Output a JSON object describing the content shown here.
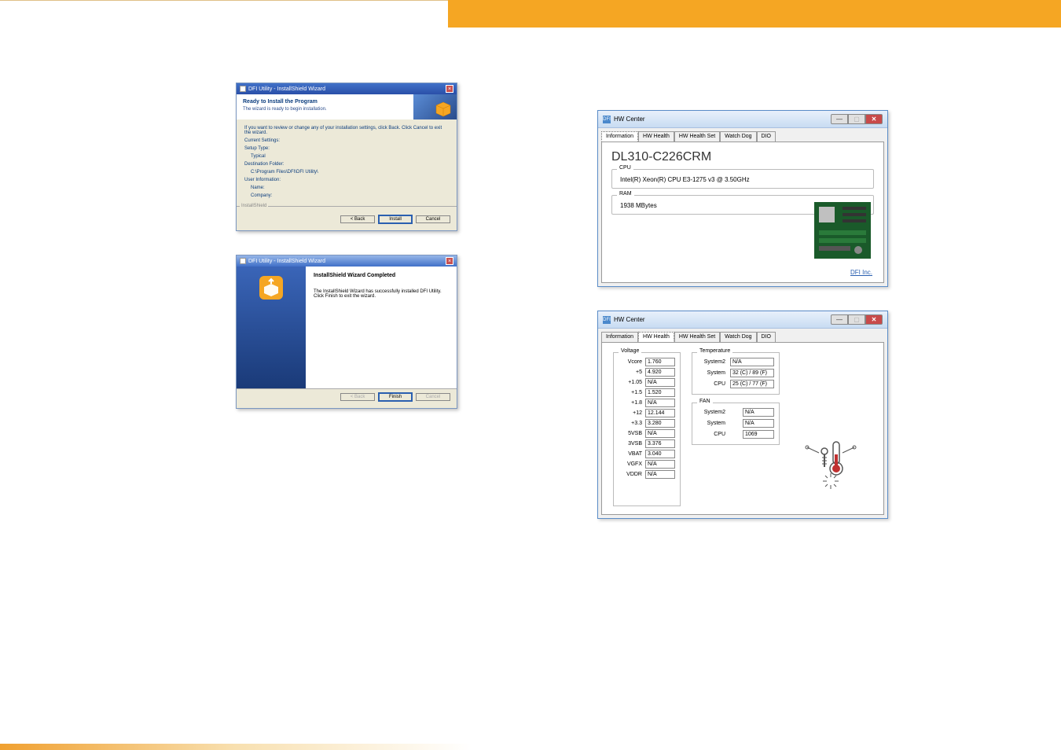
{
  "dialog1": {
    "title": "DFI Utility - InstallShield Wizard",
    "heading": "Ready to Install the Program",
    "subheading": "The wizard is ready to begin installation.",
    "instruction": "If you want to review or change any of your installation settings, click Back. Click Cancel to exit the wizard.",
    "current_settings_label": "Current Settings:",
    "setup_type_label": "Setup Type:",
    "setup_type_value": "Typical",
    "dest_folder_label": "Destination Folder:",
    "dest_folder_value": "C:\\Program Files\\DFI\\DFI Utility\\",
    "user_info_label": "User Information:",
    "name_label": "Name:",
    "company_label": "Company:",
    "sep_label": "InstallShield",
    "back_btn": "< Back",
    "install_btn": "Install",
    "cancel_btn": "Cancel"
  },
  "dialog2": {
    "title": "DFI Utility - InstallShield Wizard",
    "heading": "InstallShield Wizard Completed",
    "body1": "The InstallShield Wizard has successfully installed DFI Utility. Click Finish to exit the wizard.",
    "back_btn": "< Back",
    "finish_btn": "Finish",
    "cancel_btn": "Cancel"
  },
  "hw1": {
    "icon_text": "DFI",
    "title": "HW Center",
    "tabs": {
      "info": "Information",
      "hw_health": "HW Health",
      "hw_health_set": "HW Health Set",
      "watch_dog": "Watch Dog",
      "dio": "DIO"
    },
    "product": "DL310-C226CRM",
    "cpu_label": "CPU",
    "cpu_value": "Intel(R) Xeon(R) CPU E3-1275 v3 @ 3.50GHz",
    "ram_label": "RAM",
    "ram_value": "1938 MBytes",
    "link": "DFI Inc."
  },
  "hw2": {
    "title": "HW Center",
    "tabs": {
      "info": "Information",
      "hw_health": "HW Health",
      "hw_health_set": "HW Health Set",
      "watch_dog": "Watch Dog",
      "dio": "DIO"
    },
    "voltage_label": "Voltage",
    "voltages": [
      {
        "lbl": "Vcore",
        "val": "1.760"
      },
      {
        "lbl": "+5",
        "val": "4.920"
      },
      {
        "lbl": "+1.05",
        "val": "N/A"
      },
      {
        "lbl": "+1.5",
        "val": "1.520"
      },
      {
        "lbl": "+1.8",
        "val": "N/A"
      },
      {
        "lbl": "+12",
        "val": "12.144"
      },
      {
        "lbl": "+3.3",
        "val": "3.280"
      },
      {
        "lbl": "5VSB",
        "val": "N/A"
      },
      {
        "lbl": "3VSB",
        "val": "3.376"
      },
      {
        "lbl": "VBAT",
        "val": "3.040"
      },
      {
        "lbl": "VGFX",
        "val": "N/A"
      },
      {
        "lbl": "VDDR",
        "val": "N/A"
      }
    ],
    "temp_label": "Temperature",
    "temps": [
      {
        "lbl": "System2",
        "val": "N/A"
      },
      {
        "lbl": "System",
        "val": "32 (C) / 89 (F)"
      },
      {
        "lbl": "CPU",
        "val": "25 (C) / 77 (F)"
      }
    ],
    "fan_label": "FAN",
    "fans": [
      {
        "lbl": "System2",
        "val": "N/A"
      },
      {
        "lbl": "System",
        "val": "N/A"
      },
      {
        "lbl": "CPU",
        "val": "1069"
      }
    ]
  }
}
